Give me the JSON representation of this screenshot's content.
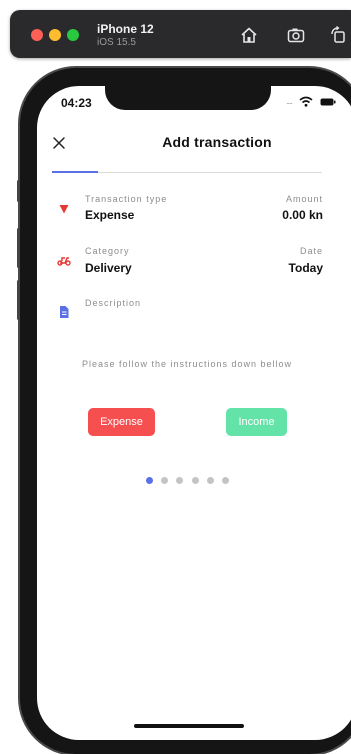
{
  "simulator": {
    "device_name": "iPhone 12",
    "os_version": "iOS 15.5",
    "icons": [
      "home-icon",
      "screenshot-icon",
      "rotate-icon"
    ]
  },
  "status_bar": {
    "time": "04:23",
    "signal": "....",
    "icons": [
      "wifi-icon",
      "battery-icon"
    ]
  },
  "header": {
    "title": "Add transaction",
    "close_icon": "close-icon"
  },
  "stepper": {
    "total": 6,
    "active": 0
  },
  "fields": {
    "transaction_type": {
      "label": "Transaction type",
      "value": "Expense",
      "icon": "triangle-down-icon",
      "color": "#e53935"
    },
    "amount": {
      "label": "Amount",
      "value": "0.00 kn"
    },
    "category": {
      "label": "Category",
      "value": "Delivery",
      "icon": "scooter-icon",
      "color": "#e53935"
    },
    "date": {
      "label": "Date",
      "value": "Today"
    },
    "description": {
      "label": "Description",
      "value": "",
      "icon": "document-icon",
      "color": "#5b6fe6"
    }
  },
  "instructions": "Please follow the instructions down bellow",
  "buttons": {
    "expense": {
      "label": "Expense",
      "color": "#f54f4f"
    },
    "income": {
      "label": "Income",
      "color": "#63e3a8"
    }
  },
  "colors": {
    "accent": "#5b6fe6",
    "expense": "#e53935",
    "income": "#63e3a8"
  }
}
